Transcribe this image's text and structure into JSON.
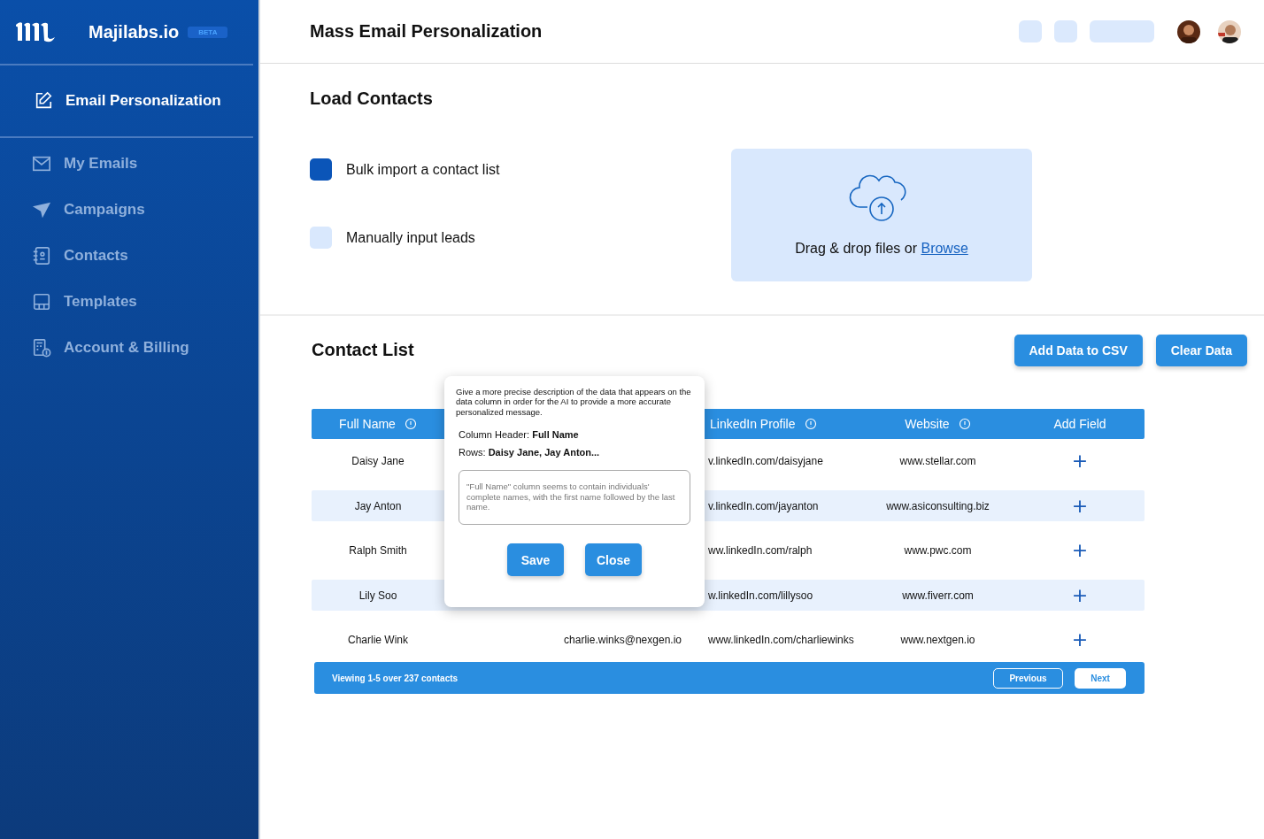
{
  "brand": {
    "name": "Majilabs.io",
    "badge": "BETA"
  },
  "sidebar": {
    "active": {
      "label": "Email Personalization",
      "selected": true
    },
    "items": [
      {
        "label": "My Emails",
        "selected": false
      },
      {
        "label": "Campaigns",
        "selected": false
      },
      {
        "label": "Contacts",
        "selected": false
      },
      {
        "label": "Templates",
        "selected": false
      },
      {
        "label": "Account & Billing",
        "selected": false
      }
    ]
  },
  "header": {
    "title": "Mass Email Personalization"
  },
  "load_contacts": {
    "title": "Load Contacts",
    "options": [
      {
        "label": "Bulk import a contact list",
        "selected": true
      },
      {
        "label": "Manually input leads",
        "selected": false
      }
    ],
    "dropzone": {
      "text": "Drag & drop files or",
      "link": "Browse"
    }
  },
  "contact_list": {
    "title": "Contact List",
    "buttons": [
      "Add Data to CSV",
      "Clear Data"
    ],
    "columns": [
      "Full Name",
      "LinkedIn Profile",
      "Website",
      "Add Field"
    ],
    "rows": [
      {
        "name": "Daisy Jane",
        "linkedin": "v.linkedIn.com/daisyjane",
        "website": "www.stellar.com",
        "add": "+"
      },
      {
        "name": "Jay Anton",
        "linkedin": "v.linkedIn.com/jayanton",
        "website": "www.asiconsulting.biz",
        "add": "+"
      },
      {
        "name": "Ralph Smith",
        "linkedin": "ww.linkedIn.com/ralph",
        "website": "www.pwc.com",
        "add": "+"
      },
      {
        "name": "Lily Soo",
        "linkedin": "w.linkedIn.com/lillysoo",
        "website": "www.fiverr.com",
        "add": "+"
      },
      {
        "name": "Charlie Wink",
        "email": "charlie.winks@nexgen.io",
        "linkedin": "www.linkedIn.com/charliewinks",
        "website": "www.nextgen.io",
        "add": "+"
      }
    ],
    "footer": {
      "summary": "Viewing 1-5 over 237 contacts",
      "previous": "Previous",
      "next": "Next"
    }
  },
  "popover": {
    "description": "Give a more precise description of the data that appears on the data column in order for the AI to provide a more accurate personalized message.",
    "header_line": "Column Header: **Full Name**",
    "rows_line": "Rows: **Daisy Jane, Jay Anton...**",
    "textarea": "\"Full Name\" column seems to contain individuals' complete names, with the first name followed by the last name.",
    "buttons": [
      "Save",
      "Close"
    ]
  }
}
